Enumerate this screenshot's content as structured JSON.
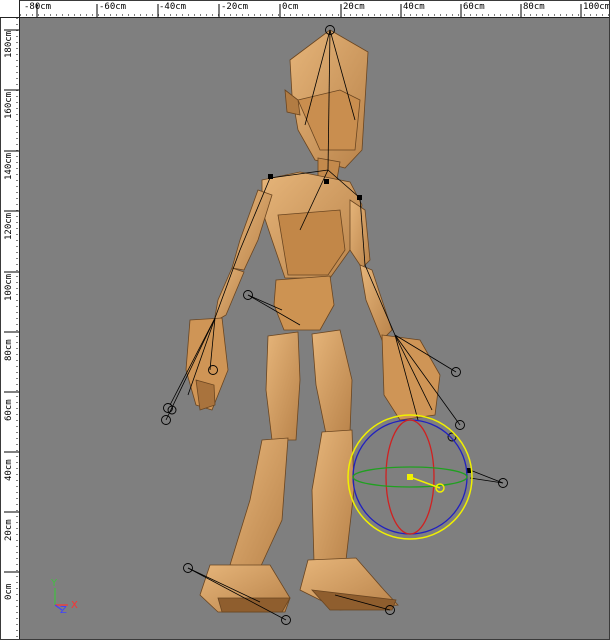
{
  "viewport": {
    "background": "#7f7f7f",
    "ruler_top_labels": [
      "-80cm",
      "-60cm",
      "-40cm",
      "-20cm",
      "0cm",
      "20cm",
      "40cm",
      "60cm",
      "80cm",
      "100cm"
    ],
    "ruler_left_labels": [
      "180cm",
      "160cm",
      "140cm",
      "120cm",
      "100cm",
      "80cm",
      "60cm",
      "40cm",
      "20cm",
      "0cm"
    ]
  },
  "axis_gizmo": {
    "y_label": "Y",
    "x_label": "X",
    "z_label": "Z",
    "colors": {
      "x": "#ff3030",
      "y": "#40c040",
      "z": "#4040ff"
    }
  },
  "model": {
    "skin_color": "#d8a15e",
    "shade_color": "#9c6a36",
    "bone_color": "#000000",
    "manipulator_colors": {
      "outer": "#f0f000",
      "x_ring": "#d02020",
      "y_ring": "#2020c0",
      "z_ring": "#20a020"
    }
  }
}
